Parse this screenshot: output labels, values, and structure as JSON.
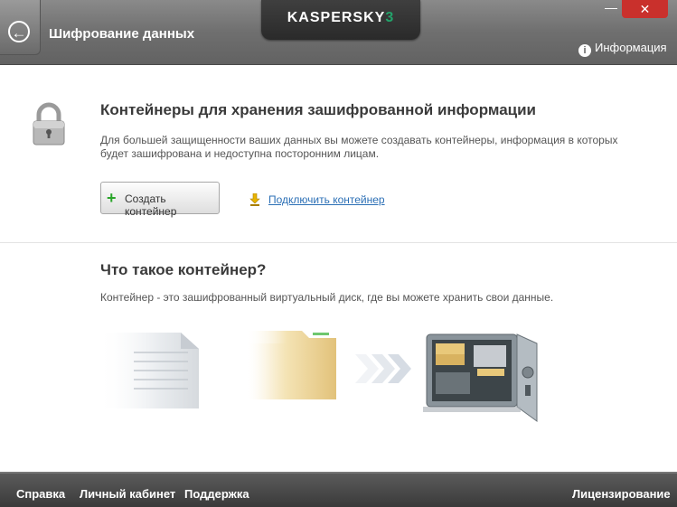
{
  "header": {
    "back_label": "←",
    "title": "Шифрование данных",
    "logo_main": "KASPERSKY",
    "logo_lab": "3",
    "minimize_label": "—",
    "close_label": "✕",
    "info_icon": "i",
    "info_label": "Информация"
  },
  "main": {
    "title": "Контейнеры для хранения зашифрованной информации",
    "description": "Для большей защищенности ваших данных вы можете создавать контейнеры, информация в которых будет зашифрована и недоступна посторонним лицам.",
    "create_icon": "+",
    "create_button": "Создать контейнер",
    "connect_link": "Подключить контейнер"
  },
  "about": {
    "title": "Что такое контейнер?",
    "description": "Контейнер - это зашифрованный виртуальный диск, где вы можете хранить свои данные."
  },
  "footer": {
    "help": "Справка",
    "account": "Личный кабинет",
    "support": "Поддержка",
    "licensing": "Лицензирование"
  },
  "colors": {
    "header_bg": "#6f6f6f",
    "link": "#2b6fb5",
    "close": "#c9302c",
    "accent_green": "#2aa52a"
  }
}
